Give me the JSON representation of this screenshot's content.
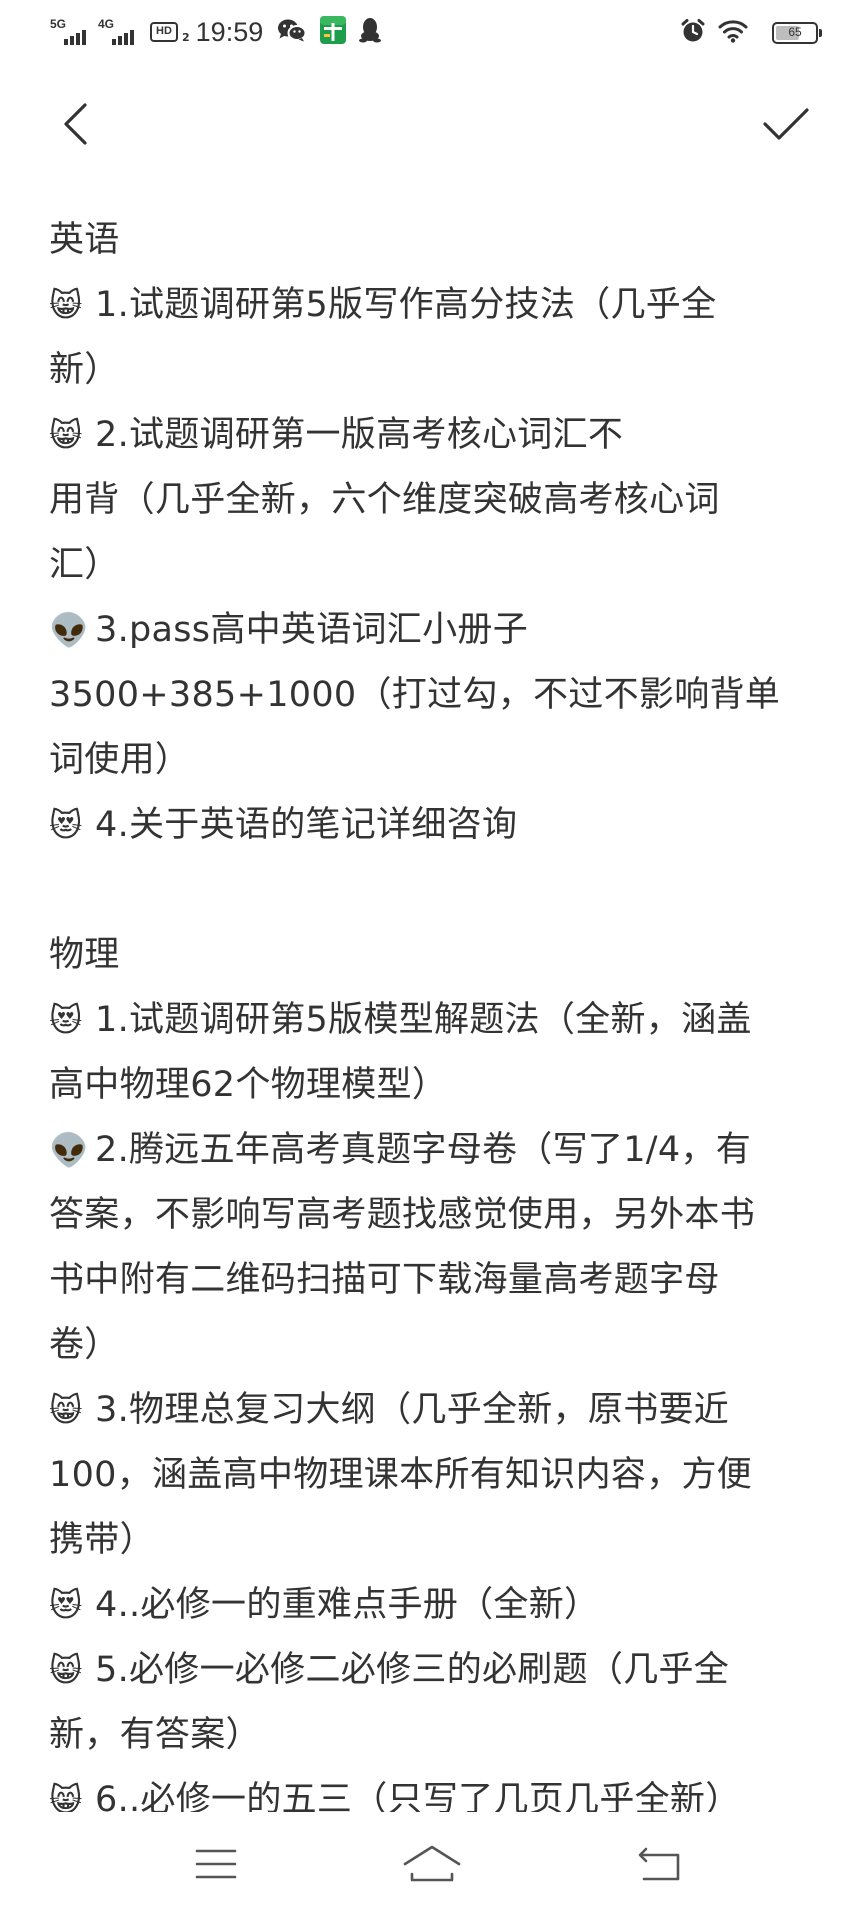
{
  "status_bar": {
    "network1": "5G",
    "network2": "4G",
    "hd_badge": "HD",
    "hd_sub": "2",
    "time": "19:59",
    "battery_level": "65",
    "battery_fraction": 0.65
  },
  "toolbar": {
    "back_icon": "chevron-left-icon",
    "confirm_icon": "checkmark-icon"
  },
  "note": {
    "lines": [
      {
        "emoji": "",
        "text": "英语"
      },
      {
        "emoji": "😸",
        "text": "1.试题调研第5版写作高分技法（几乎全"
      },
      {
        "emoji": "",
        "text": "新）"
      },
      {
        "emoji": "😸",
        "text": "2.试题调研第一版高考核心词汇不"
      },
      {
        "emoji": "",
        "text": "用背（几乎全新，六个维度突破高考核心词"
      },
      {
        "emoji": "",
        "text": "汇）"
      },
      {
        "emoji": "👽",
        "text": "3.pass高中英语词汇小册子"
      },
      {
        "emoji": "",
        "text": "3500+385+1000（打过勾，不过不影响背单"
      },
      {
        "emoji": "",
        "text": "词使用）"
      },
      {
        "emoji": "😻",
        "text": "4.关于英语的笔记详细咨询"
      },
      {
        "emoji": "",
        "text": ""
      },
      {
        "emoji": "",
        "text": "物理"
      },
      {
        "emoji": "😻",
        "text": "1.试题调研第5版模型解题法（全新，涵盖"
      },
      {
        "emoji": "",
        "text": "高中物理62个物理模型）"
      },
      {
        "emoji": "👽",
        "text": "2.腾远五年高考真题字母卷（写了1/4，有"
      },
      {
        "emoji": "",
        "text": "答案，不影响写高考题找感觉使用，另外本书"
      },
      {
        "emoji": "",
        "text": "书中附有二维码扫描可下载海量高考题字母"
      },
      {
        "emoji": "",
        "text": "卷）"
      },
      {
        "emoji": "😸",
        "text": "3.物理总复习大纲（几乎全新，原书要近"
      },
      {
        "emoji": "",
        "text": "100，涵盖高中物理课本所有知识内容，方便"
      },
      {
        "emoji": "",
        "text": "携带）"
      },
      {
        "emoji": "😻",
        "text": "4..必修一的重难点手册（全新）"
      },
      {
        "emoji": "😸",
        "text": "5.必修一必修二必修三的必刷题（几乎全"
      },
      {
        "emoji": "",
        "text": "新，有答案）"
      },
      {
        "emoji": "😸",
        "text": "6..必修一的五三（只写了几页几乎全新）"
      }
    ]
  },
  "nav_bar": {
    "menu_icon": "menu-icon",
    "home_icon": "home-icon",
    "back_icon": "back-arrow-icon"
  }
}
